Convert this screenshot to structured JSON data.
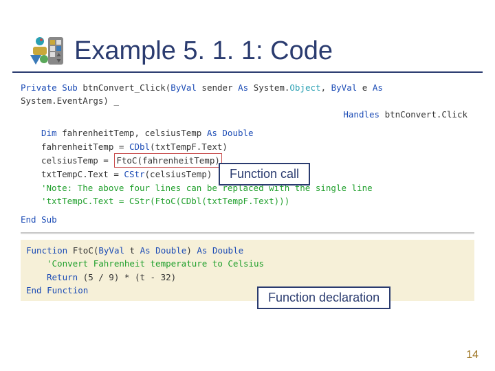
{
  "header": {
    "title": "Example 5. 1. 1: Code"
  },
  "code": {
    "l1a": "Private Sub",
    "l1b": " btnConvert_Click(",
    "l1c": "ByVal",
    "l1d": " sender ",
    "l1e": "As",
    "l1f": " System.",
    "l1g": "Object",
    "l1h": ", ",
    "l1i": "ByVal",
    "l1j": " e ",
    "l1k": "As",
    "l1l": " System.EventArgs) _",
    "l2a": "Handles",
    "l2b": " btnConvert.Click",
    "l3a": "Dim",
    "l3b": " fahrenheitTemp, celsiusTemp ",
    "l3c": "As Double",
    "l4a": "fahrenheitTemp = ",
    "l4b": "CDbl",
    "l4c": "(txtTempF.Text)",
    "l5a": "celsiusTemp = ",
    "l5b": "FtoC(fahrenheitTemp)",
    "l6a": "txtTempC.Text = ",
    "l6b": "CStr",
    "l6c": "(celsiusTemp)",
    "l7": "'Note: The above four lines can be replaced with the single line",
    "l8": "'txtTempC.Text = CStr(FtoC(CDbl(txtTempF.Text)))",
    "l9": "End Sub",
    "f1a": "Function",
    "f1b": " FtoC(",
    "f1c": "ByVal",
    "f1d": " t ",
    "f1e": "As Double",
    "f1f": ") ",
    "f1g": "As Double",
    "f2": "'Convert Fahrenheit temperature to Celsius",
    "f3a": "Return",
    "f3b": " (5 / 9) * (t - 32)",
    "f4": "End Function"
  },
  "callouts": {
    "call": "Function call",
    "decl": "Function declaration"
  },
  "page": "14"
}
